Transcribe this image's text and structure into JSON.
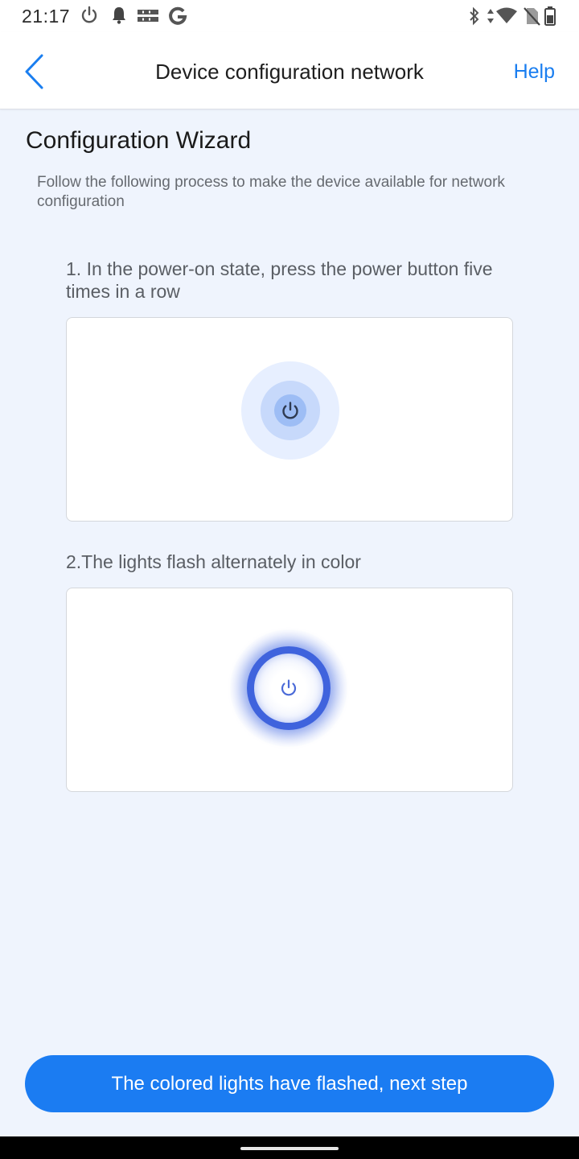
{
  "status_bar": {
    "time": "21:17",
    "icons": [
      "power-icon",
      "notification-bell-icon",
      "mob-rog-icon",
      "google-icon",
      "bluetooth-icon",
      "data-arrows-icon",
      "wifi-icon",
      "no-sim-icon",
      "battery-icon"
    ]
  },
  "header": {
    "title": "Device configuration network",
    "help_label": "Help",
    "accent_color": "#1a7ef0"
  },
  "wizard": {
    "title": "Configuration Wizard",
    "description": "Follow the following process to make the device available for network configuration"
  },
  "steps": [
    {
      "label": "1. In the power-on state, press the power button five times in a row",
      "icon": "power-icon"
    },
    {
      "label": "2.The lights flash alternately in color",
      "icon": "power-icon"
    }
  ],
  "next_button": {
    "label": "The colored lights have flashed, next step",
    "color": "#1b7cf2"
  }
}
